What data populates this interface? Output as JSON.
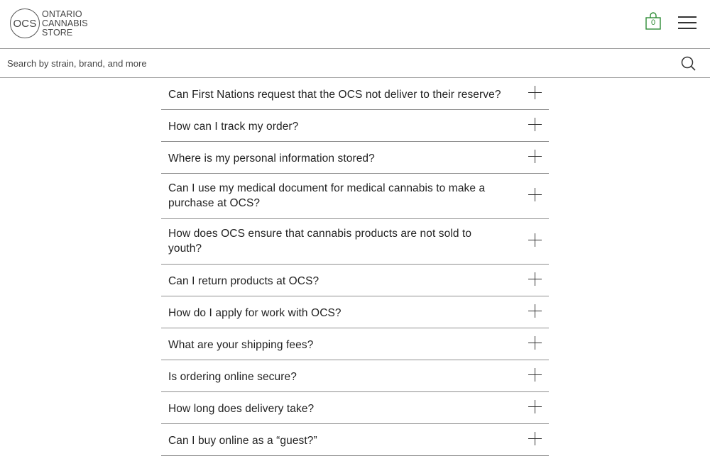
{
  "header": {
    "logo_mark": "OCS",
    "logo_line1": "ONTARIO",
    "logo_line2": "CANNABIS",
    "logo_line3": "STORE",
    "cart_count": "0",
    "cart_icon": "shopping-bag-icon",
    "menu_icon": "hamburger-menu-icon",
    "accent_color": "#2e8b35"
  },
  "search": {
    "placeholder": "Search by strain, brand, and more",
    "value": "",
    "icon": "search-icon"
  },
  "faq": {
    "items": [
      {
        "question": "Can First Nations request that the OCS not deliver to their reserve?"
      },
      {
        "question": "How can I track my order?"
      },
      {
        "question": "Where is my personal information stored?"
      },
      {
        "question": "Can I use my medical document for medical cannabis to make a purchase at OCS?"
      },
      {
        "question": "How does OCS ensure that cannabis products are not sold to youth?"
      },
      {
        "question": "Can I return products at OCS?"
      },
      {
        "question": "How do I apply for work with OCS?"
      },
      {
        "question": "What are your shipping fees?"
      },
      {
        "question": "Is ordering online secure?"
      },
      {
        "question": "How long does delivery take?"
      },
      {
        "question": "Can I buy online as a “guest?”"
      }
    ]
  }
}
